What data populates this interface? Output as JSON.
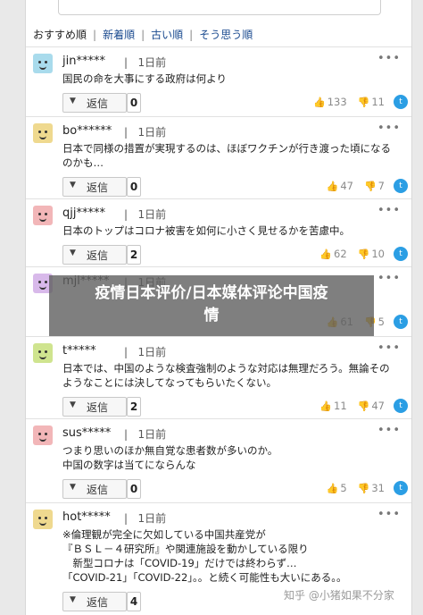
{
  "sort": {
    "items": [
      "おすすめ順",
      "新着順",
      "古い順",
      "そう思う順"
    ],
    "separator": "|"
  },
  "reply_label": "返信",
  "comments": [
    {
      "user": "jin*****",
      "time": "1日前",
      "lines": [
        "国民の命を大事にする政府は何より"
      ],
      "replies": "0",
      "likes": "133",
      "dislikes": "11",
      "avatar_color": "#a9dbec"
    },
    {
      "user": "bo******",
      "time": "1日前",
      "lines": [
        "日本で同様の措置が実現するのは、ほぼワクチンが行き渡った頃になる",
        "のかも…"
      ],
      "replies": "0",
      "likes": "47",
      "dislikes": "7",
      "avatar_color": "#efd98f"
    },
    {
      "user": "qjj*****",
      "time": "1日前",
      "lines": [
        "日本のトップはコロナ被害を如何に小さく見せるかを苦慮中。"
      ],
      "replies": "2",
      "likes": "62",
      "dislikes": "10",
      "avatar_color": "#f2b6b8"
    },
    {
      "user": "mjl*****",
      "time": "1日前",
      "lines": [
        ""
      ],
      "replies": "",
      "likes": "61",
      "dislikes": "5",
      "avatar_color": "#d8b9ea"
    },
    {
      "user": "t*****",
      "time": "1日前",
      "lines": [
        "日本では、中国のような検査強制のような対応は無理だろう。無論その",
        "ようなことには決してなってもらいたくない。"
      ],
      "replies": "2",
      "likes": "11",
      "dislikes": "47",
      "avatar_color": "#cfe48f"
    },
    {
      "user": "sus*****",
      "time": "1日前",
      "lines": [
        "つまり思いのほか無自覚な患者数が多いのか。",
        "中国の数字は当てにならんな"
      ],
      "replies": "0",
      "likes": "5",
      "dislikes": "31",
      "avatar_color": "#f2b6b8"
    },
    {
      "user": "hot*****",
      "time": "1日前",
      "lines": [
        "※倫理観が完全に欠如している中国共産党が",
        "『ＢＳＬ－４研究所』や関連施設を動かしている限り",
        "　新型コロナは「COVID-19」だけでは終わらず…",
        "「COVID-21」「COVID-22」。。と続く可能性も大いにある。。"
      ],
      "replies": "4",
      "likes": "",
      "dislikes": "",
      "avatar_color": "#efd98f"
    }
  ],
  "banner": {
    "line1": "疫情日本评价/日本媒体评论中国疫",
    "line2": "情"
  },
  "watermark": "知乎 @小猪如果不分家"
}
